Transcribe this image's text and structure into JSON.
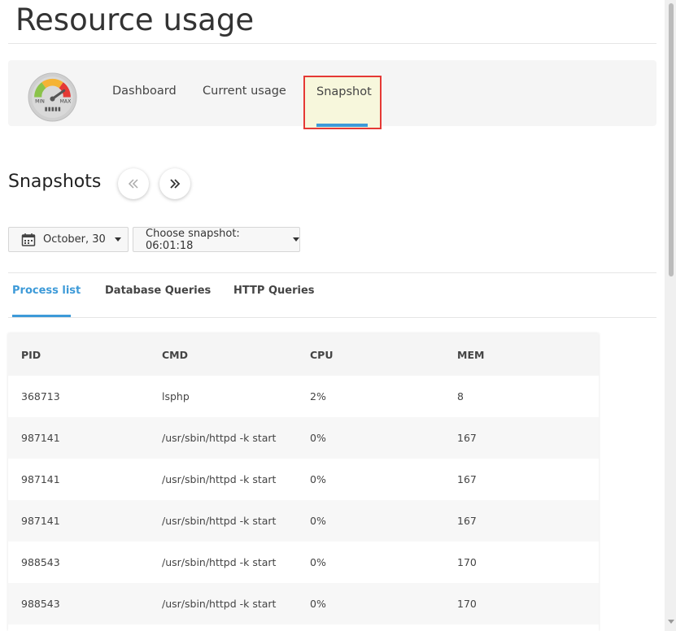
{
  "page": {
    "title": "Resource usage"
  },
  "nav": {
    "tabs": [
      {
        "label": "Dashboard"
      },
      {
        "label": "Current usage"
      },
      {
        "label": "Snapshot"
      }
    ],
    "active_index": 2,
    "gauge": {
      "min_label": "MIN",
      "max_label": "MAX"
    }
  },
  "snapshots": {
    "title": "Snapshots",
    "prev_icon": "double-chevron-left-icon",
    "next_icon": "double-chevron-right-icon",
    "date_label": "October, 30",
    "snapshot_label": "Choose snapshot: 06:01:18"
  },
  "subtabs": [
    {
      "label": "Process list"
    },
    {
      "label": "Database Queries"
    },
    {
      "label": "HTTP Queries"
    }
  ],
  "table": {
    "columns": [
      "PID",
      "CMD",
      "CPU",
      "MEM"
    ],
    "rows": [
      [
        "368713",
        "lsphp",
        "2%",
        "8"
      ],
      [
        "987141",
        "/usr/sbin/httpd -k start",
        "0%",
        "167"
      ],
      [
        "987141",
        "/usr/sbin/httpd -k start",
        "0%",
        "167"
      ],
      [
        "987141",
        "/usr/sbin/httpd -k start",
        "0%",
        "167"
      ],
      [
        "988543",
        "/usr/sbin/httpd -k start",
        "0%",
        "170"
      ],
      [
        "988543",
        "/usr/sbin/httpd -k start",
        "0%",
        "170"
      ]
    ]
  },
  "colors": {
    "accent": "#3d9ad8",
    "highlight_border": "#e53935",
    "highlight_bg": "#f7f7dc"
  }
}
